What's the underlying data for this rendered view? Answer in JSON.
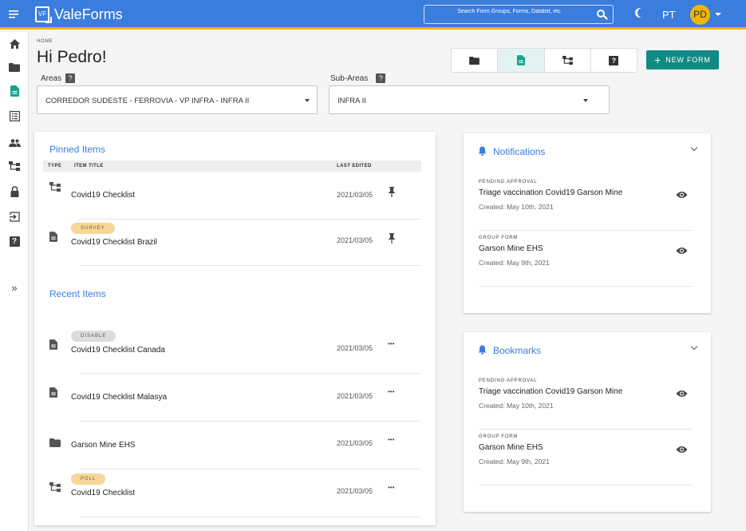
{
  "app": {
    "title": "ValeForms",
    "logo_text": "VF"
  },
  "search": {
    "placeholder": "Search Form Groups, Forms, Datalist, etc"
  },
  "user": {
    "language": "PT",
    "initials": "PD"
  },
  "sidebar": {
    "items": [
      {
        "icon": "home-icon"
      },
      {
        "icon": "folder-icon"
      },
      {
        "icon": "document-icon",
        "active": true
      },
      {
        "icon": "list-icon"
      },
      {
        "icon": "people-icon"
      },
      {
        "icon": "hierarchy-icon"
      },
      {
        "icon": "lock-icon"
      },
      {
        "icon": "exit-icon"
      },
      {
        "icon": "help-icon"
      },
      {
        "icon": "expand-icon"
      }
    ],
    "help_glyph": "?",
    "expand_glyph": "»"
  },
  "header": {
    "breadcrumb": "HOME",
    "greeting": "Hi Pedro!",
    "new_form_label": "NEW FORM",
    "new_form_glyph": "+",
    "help_glyph": "?"
  },
  "colors": {
    "primary": "#3b7ddd",
    "accent": "#14a58a",
    "button": "#108a82",
    "gold": "#f2b600"
  },
  "filters": {
    "areas": {
      "label": "Areas",
      "value": "CORREDOR SUDESTE - FERROVIA - VP INFRA - INFRA II"
    },
    "sub_areas": {
      "label": "Sub-Areas",
      "value": "INFRA II"
    }
  },
  "pinned": {
    "title": "Pinned Items",
    "columns": {
      "type": "TYPE",
      "title": "ITEM TITLE",
      "edited": "LAST EDITED"
    },
    "rows": [
      {
        "icon": "hierarchy-icon",
        "title": "Covid19 Checklist",
        "date": "2021/03/05",
        "tag": ""
      },
      {
        "icon": "document-icon",
        "title": "Covid19 Checklist Brazil",
        "date": "2021/03/05",
        "tag": "SURVEY"
      }
    ]
  },
  "recent": {
    "title": "Recent Items",
    "more_glyph": "•••",
    "rows": [
      {
        "icon": "document-icon",
        "title": "Covid19 Checklist Canada",
        "date": "2021/03/05",
        "tag": "DISABLE"
      },
      {
        "icon": "document-icon",
        "title": "Covid19 Checklist Malasya",
        "date": "2021/03/05",
        "tag": ""
      },
      {
        "icon": "folder-icon",
        "title": "Garson Mine EHS",
        "date": "2021/03/05",
        "tag": ""
      },
      {
        "icon": "hierarchy-icon",
        "title": "Covid19 Checklist",
        "date": "2021/03/05",
        "tag": "POLL"
      }
    ]
  },
  "notifications": {
    "title": "Notifications",
    "items": [
      {
        "kind": "PENDING APPROVAL",
        "title": "Triage vaccination Covid19 Garson Mine",
        "created": "Created: May 10th, 2021"
      },
      {
        "kind": "GROUP FORM",
        "title": "Garson Mine EHS",
        "created": "Created: May 9th, 2021"
      }
    ]
  },
  "bookmarks": {
    "title": "Bookmarks",
    "items": [
      {
        "kind": "PENDING APPROVAL",
        "title": "Triage vaccination Covid19 Garson Mine",
        "created": "Created: May 10th, 2021"
      },
      {
        "kind": "GROUP FORM",
        "title": "Garson Mine EHS",
        "created": "Created: May 9th, 2021"
      }
    ]
  }
}
